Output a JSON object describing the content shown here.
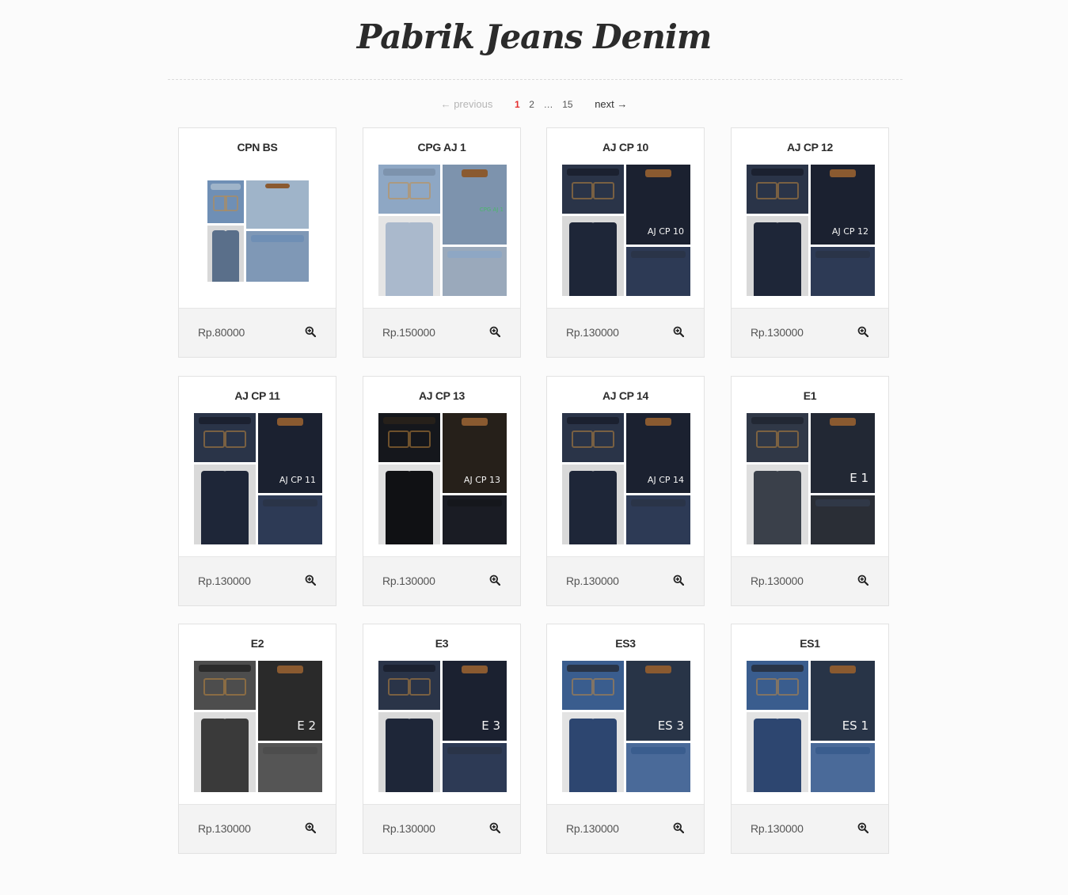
{
  "site": {
    "title": "Pabrik  Jeans Denim"
  },
  "pagination": {
    "previous_label": "← previous",
    "pages": [
      "1",
      "2",
      "…",
      "15"
    ],
    "current": "1",
    "next_label": "next →"
  },
  "colors": {
    "accent": "#e53030",
    "card_background": "#ffffff",
    "card_footer": "#f3f3f3",
    "page_background": "#fbfbfb"
  },
  "products": [
    {
      "name": "CPN BS",
      "price": "Rp.80000",
      "photo_tag": "",
      "tone": "light-blue"
    },
    {
      "name": "CPG AJ 1",
      "price": "Rp.150000",
      "photo_tag": "CPG AJ 1",
      "tone": "light-wash"
    },
    {
      "name": "AJ CP 10",
      "price": "Rp.130000",
      "photo_tag": "AJ CP 10",
      "tone": "dark"
    },
    {
      "name": "AJ CP 12",
      "price": "Rp.130000",
      "photo_tag": "AJ CP 12",
      "tone": "dark"
    },
    {
      "name": "AJ CP 11",
      "price": "Rp.130000",
      "photo_tag": "AJ CP 11",
      "tone": "dark"
    },
    {
      "name": "AJ CP 13",
      "price": "Rp.130000",
      "photo_tag": "AJ CP 13",
      "tone": "black"
    },
    {
      "name": "AJ CP 14",
      "price": "Rp.130000",
      "photo_tag": "AJ CP 14",
      "tone": "dark"
    },
    {
      "name": "E1",
      "price": "Rp.130000",
      "photo_tag": "E 1",
      "tone": "dark-grey"
    },
    {
      "name": "E2",
      "price": "Rp.130000",
      "photo_tag": "E 2",
      "tone": "grey-black"
    },
    {
      "name": "E3",
      "price": "Rp.130000",
      "photo_tag": "E 3",
      "tone": "dark"
    },
    {
      "name": "ES3",
      "price": "Rp.130000",
      "photo_tag": "ES 3",
      "tone": "mid-blue"
    },
    {
      "name": "ES1",
      "price": "Rp.130000",
      "photo_tag": "ES 1",
      "tone": "mid-blue"
    }
  ],
  "icons": {
    "zoom": "zoom-in-icon"
  }
}
